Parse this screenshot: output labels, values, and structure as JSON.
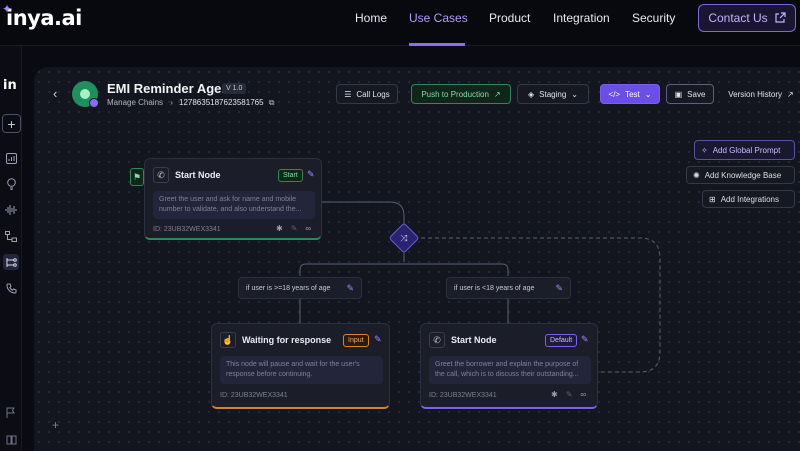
{
  "brand": {
    "logo": "inya.ai"
  },
  "nav": {
    "links": [
      "Home",
      "Use Cases",
      "Product",
      "Integration",
      "Security"
    ],
    "active": "Use Cases",
    "contact_label": "Contact Us"
  },
  "rail": {
    "logo": "in"
  },
  "agent": {
    "title": "EMI Reminder Agent",
    "version": "V 1.0",
    "breadcrumb_parent": "Manage Chains",
    "chain_id": "1278635187623581765"
  },
  "toolbar": {
    "call_logs": "Call Logs",
    "push": "Push to Production",
    "environment": "Staging",
    "test": "Test",
    "save": "Save",
    "version_history": "Version History"
  },
  "side_actions": {
    "global_prompt": "Add Global Prompt",
    "knowledge_base": "Add Knowledge Base",
    "integrations": "Add Integrations"
  },
  "nodes": {
    "start_top": {
      "title": "Start Node",
      "tag": "Start",
      "desc": "Greet the user and ask for name and mobile number to validate, and also understand the...",
      "id": "ID: 23UB32WEX3341"
    },
    "waiting": {
      "title": "Waiting for response",
      "tag": "Input",
      "desc": "This node will pause and wait for the user's response before continuing.",
      "id": "ID: 23UB32WEX3341"
    },
    "start_default": {
      "title": "Start Node",
      "tag": "Default",
      "desc": "Greet the borrower and explain the purpose of the call, which is to discuss their outstanding...",
      "id": "ID: 23UB32WEX3341"
    }
  },
  "conditions": {
    "left": "if user is >=18 years of age",
    "right": "if user is <18 years of age"
  },
  "colors": {
    "accent": "#8b6cf6",
    "success": "#2e8a55",
    "input": "#d9822b",
    "background": "#14161f"
  }
}
